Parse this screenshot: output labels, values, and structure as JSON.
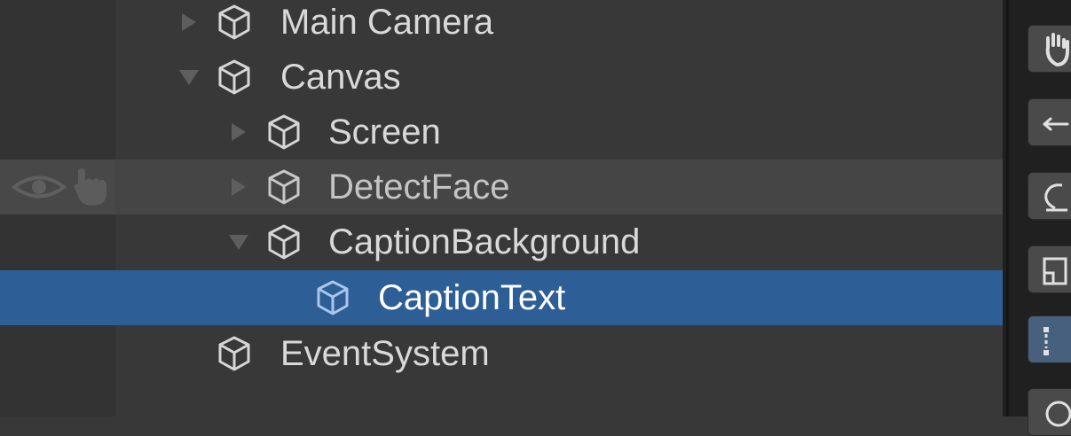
{
  "hierarchy": {
    "items": [
      {
        "label": "Main Camera",
        "expander": "collapsed"
      },
      {
        "label": "Canvas",
        "expander": "expanded"
      },
      {
        "label": "Screen",
        "expander": "collapsed"
      },
      {
        "label": "DetectFace",
        "expander": "collapsed",
        "state": "hovered",
        "gutter_icons": [
          "eye-icon",
          "hand-pointer-icon"
        ]
      },
      {
        "label": "CaptionBackground",
        "expander": "expanded"
      },
      {
        "label": "CaptionText",
        "expander": "none",
        "state": "selected"
      },
      {
        "label": "EventSystem",
        "expander": "none"
      }
    ]
  },
  "toolbar": {
    "tools": [
      "hand-tool-icon",
      "move-tool-icon",
      "rotate-tool-icon",
      "scale-tool-icon",
      "rect-tool-icon",
      "transform-tool-icon"
    ],
    "active_tool": "rect-tool-icon"
  },
  "colors": {
    "background": "#383838",
    "selection": "#2d5e95",
    "hover": "#454545",
    "text": "#d9d9d9"
  }
}
